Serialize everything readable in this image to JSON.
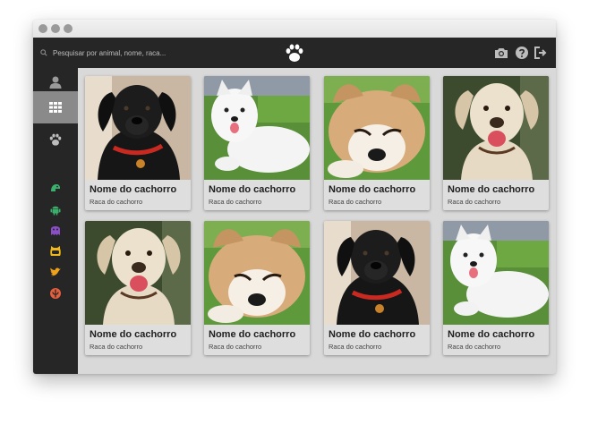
{
  "search": {
    "placeholder": "Pesquisar por animal, nome, raca..."
  },
  "colors": {
    "topbar": "#262626",
    "sidebar_active": "#8a8a8a",
    "content_bg": "#d9d9d9",
    "card_bg": "#dedede"
  },
  "topbar": {
    "logo_icon": "paw-icon",
    "icons": [
      "camera-icon",
      "help-icon",
      "logout-icon"
    ]
  },
  "sidebar": {
    "items": [
      {
        "icon": "user-icon"
      },
      {
        "icon": "grid-icon",
        "active": true
      },
      {
        "icon": "paw-icon"
      }
    ],
    "social": [
      {
        "icon": "android-head-icon",
        "color": "#3ab06b"
      },
      {
        "icon": "android-icon",
        "color": "#3ab06b"
      },
      {
        "icon": "ghost-icon",
        "color": "#8a4fc6"
      },
      {
        "icon": "github-cat-icon",
        "color": "#f0b81a"
      },
      {
        "icon": "twitter-icon",
        "color": "#f0a21a"
      },
      {
        "icon": "rebel-icon",
        "color": "#e3603e"
      }
    ]
  },
  "cards": [
    {
      "name": "Nome do cachorro",
      "breed": "Raca do cachorro",
      "photo": "black-labrador-puppy"
    },
    {
      "name": "Nome do cachorro",
      "breed": "Raca do cachorro",
      "photo": "white-samoyed"
    },
    {
      "name": "Nome do cachorro",
      "breed": "Raca do cachorro",
      "photo": "akita-puppy"
    },
    {
      "name": "Nome do cachorro",
      "breed": "Raca do cachorro",
      "photo": "yellow-labrador"
    },
    {
      "name": "Nome do cachorro",
      "breed": "Raca do cachorro",
      "photo": "yellow-labrador"
    },
    {
      "name": "Nome do cachorro",
      "breed": "Raca do cachorro",
      "photo": "akita-puppy"
    },
    {
      "name": "Nome do cachorro",
      "breed": "Raca do cachorro",
      "photo": "black-labrador-puppy"
    },
    {
      "name": "Nome do cachorro",
      "breed": "Raca do cachorro",
      "photo": "white-samoyed"
    }
  ]
}
